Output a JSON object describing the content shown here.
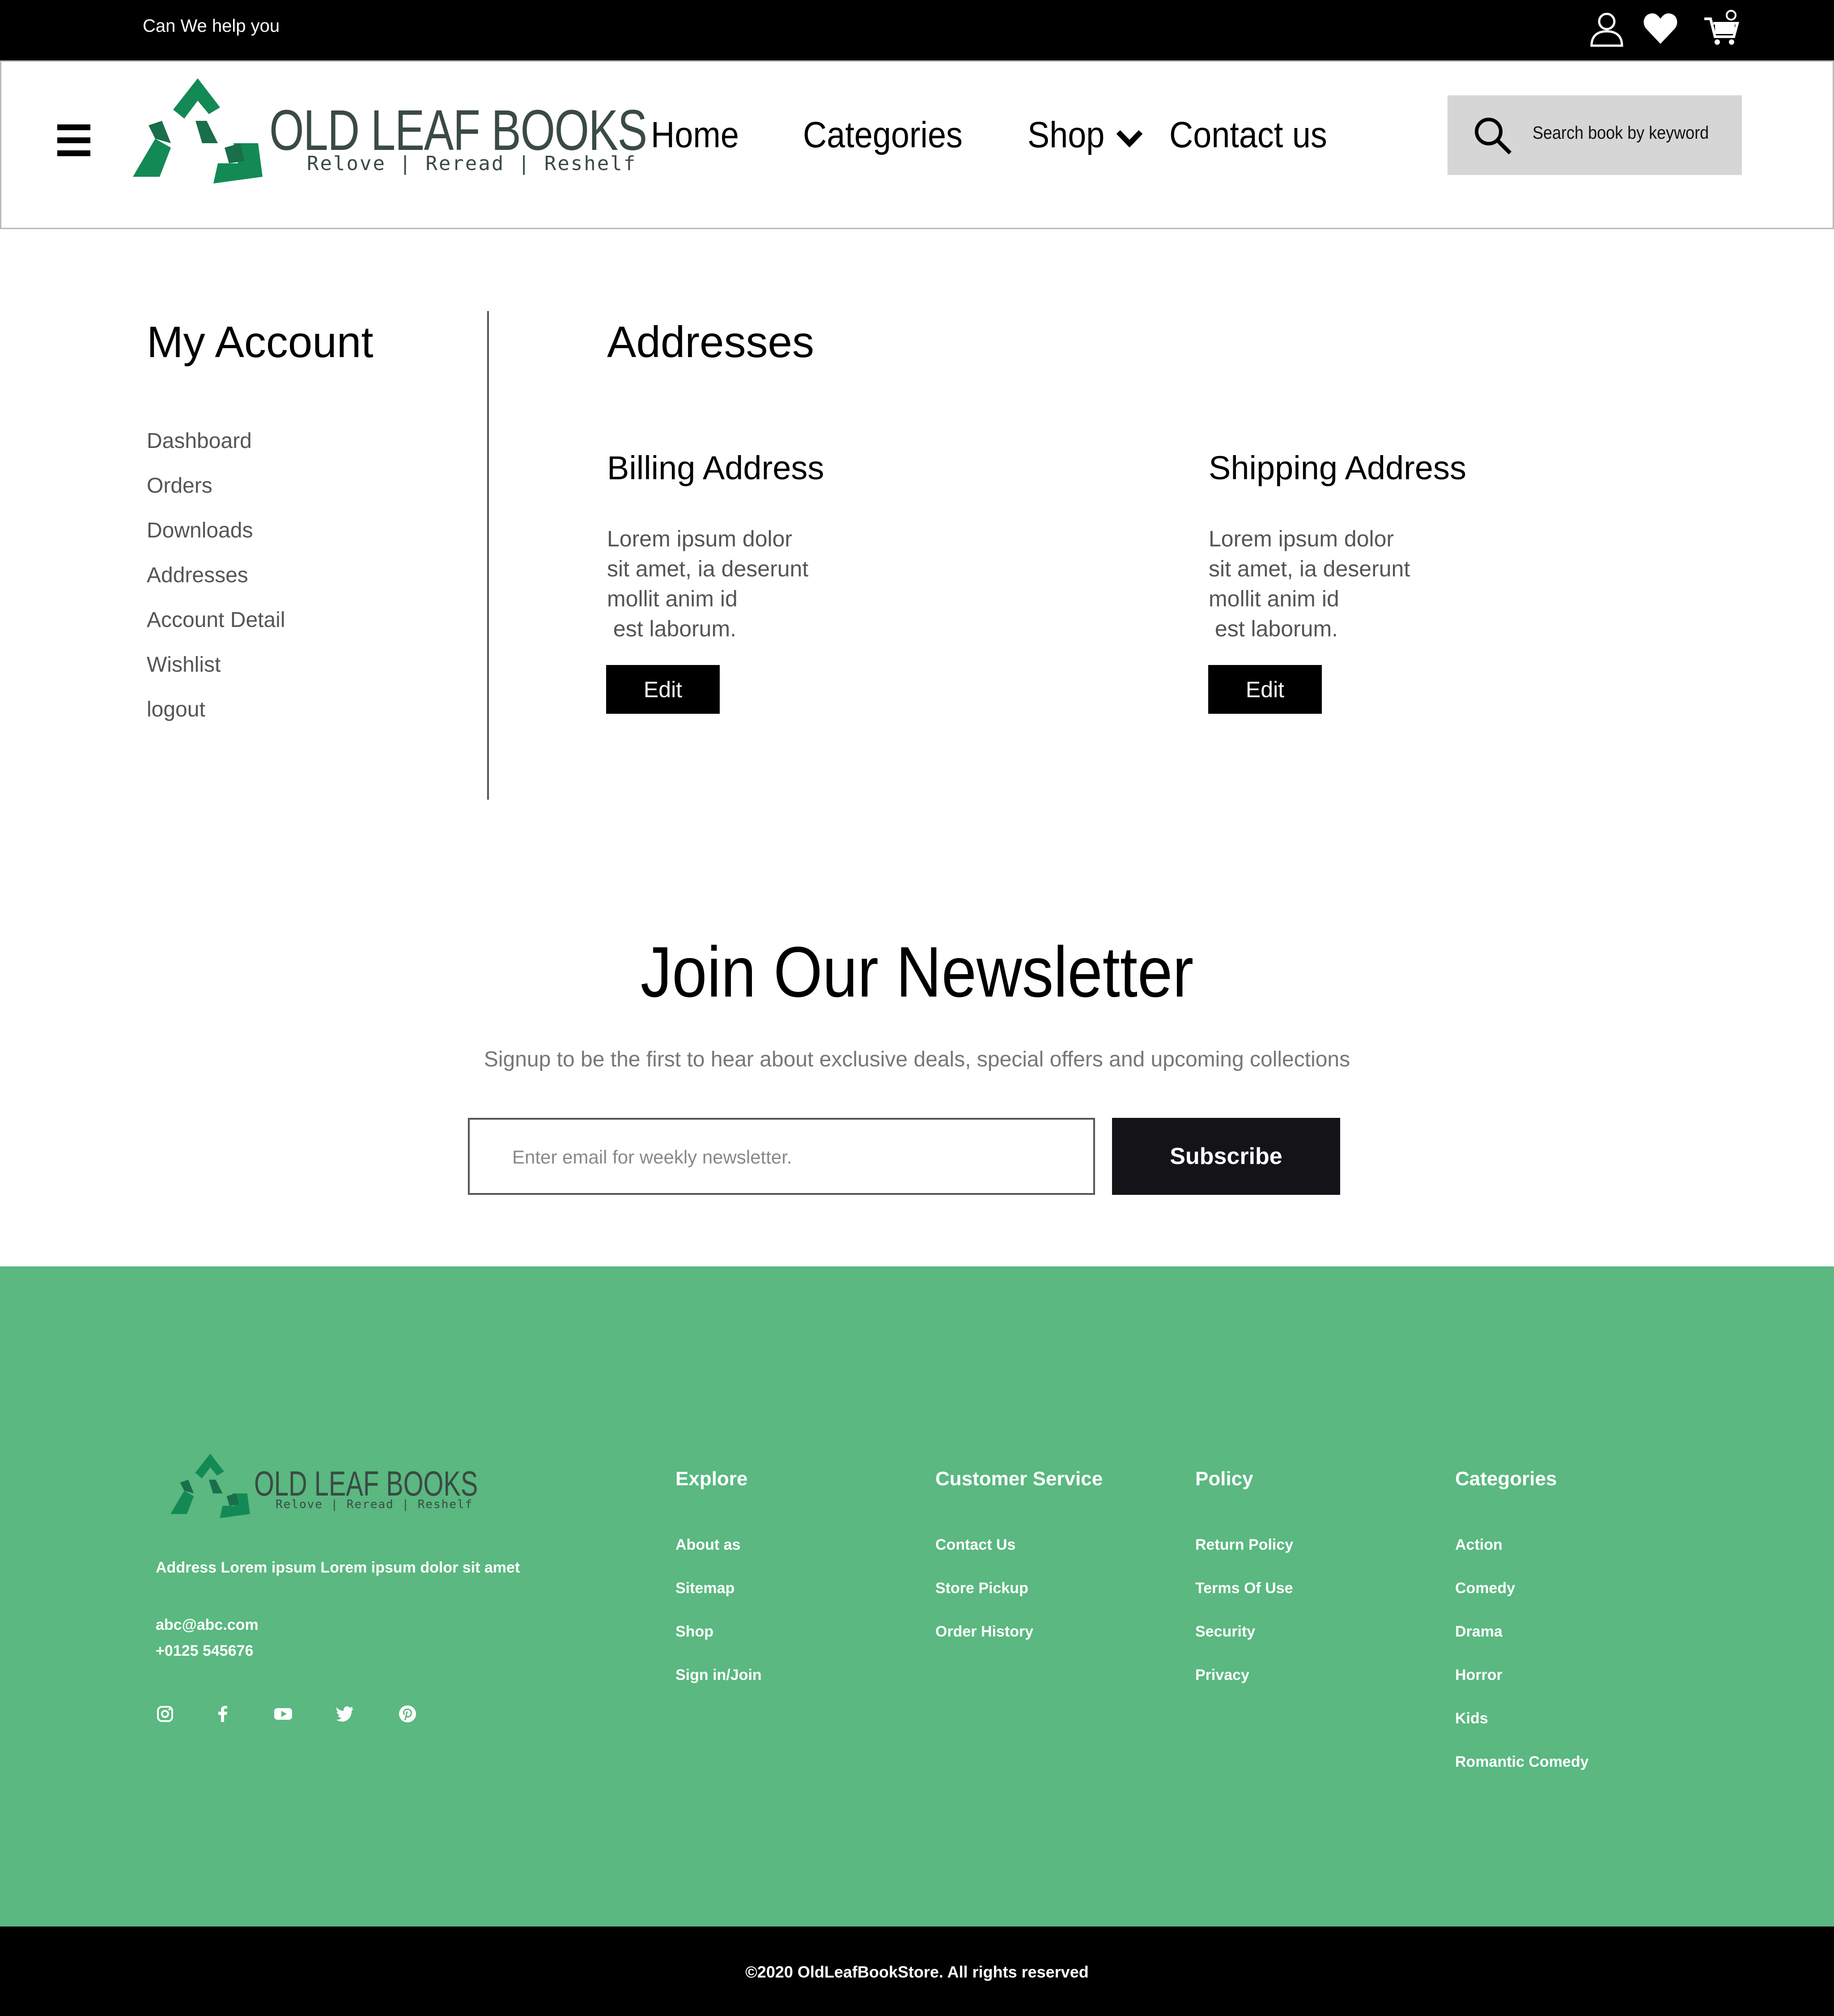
{
  "topbar": {
    "help_text": "Can We help you"
  },
  "brand": {
    "name": "OLD LEAF BOOKS",
    "tagline": "Relove | Reread | Reshelf",
    "green": "#138a55",
    "dark_text": "#3a4a44"
  },
  "nav": {
    "home": "Home",
    "categories": "Categories",
    "shop": "Shop",
    "contact": "Contact us"
  },
  "search": {
    "placeholder": "Search book by keyword"
  },
  "account": {
    "title": "My Account",
    "menu": [
      "Dashboard",
      "Orders",
      "Downloads",
      "Addresses",
      "Account Detail",
      "Wishlist",
      "logout"
    ]
  },
  "addresses": {
    "title": "Addresses",
    "billing": {
      "title": "Billing Address",
      "lines": [
        "Lorem ipsum dolor",
        "sit amet, ia deserunt",
        "mollit anim id",
        " est laborum."
      ],
      "edit_label": "Edit"
    },
    "shipping": {
      "title": "Shipping Address",
      "lines": [
        "Lorem ipsum dolor",
        "sit amet, ia deserunt",
        "mollit anim id",
        " est laborum."
      ],
      "edit_label": "Edit"
    }
  },
  "newsletter": {
    "title": "Join Our Newsletter",
    "subtitle": "Signup to be the first to hear about exclusive deals, special offers and upcoming collections",
    "placeholder": "Enter email for weekly newsletter.",
    "button": "Subscribe"
  },
  "footer": {
    "bg_color": "#5ab880",
    "address": "Address Lorem ipsum Lorem ipsum dolor sit amet",
    "email": "abc@abc.com",
    "phone": "+0125 545676",
    "social_icons": [
      "instagram-icon",
      "facebook-icon",
      "youtube-icon",
      "twitter-icon",
      "pinterest-icon"
    ],
    "columns": [
      {
        "title": "Explore",
        "links": [
          "About as",
          "Sitemap",
          "Shop",
          "Sign in/Join"
        ]
      },
      {
        "title": "Customer Service",
        "links": [
          "Contact Us",
          "Store Pickup",
          "Order History"
        ]
      },
      {
        "title": "Policy",
        "links": [
          "Return Policy",
          "Terms Of Use",
          "Security",
          "Privacy"
        ]
      },
      {
        "title": "Categories",
        "links": [
          "Action",
          "Comedy",
          "Drama",
          "Horror",
          "Kids",
          "Romantic Comedy"
        ]
      }
    ],
    "copyright": "©2020 OldLeafBookStore. All rights reserved"
  }
}
